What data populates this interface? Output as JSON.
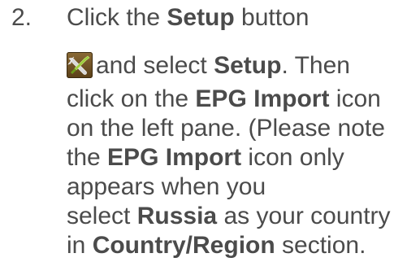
{
  "step": {
    "number": "2.",
    "line1": {
      "pre": "Click the ",
      "bold": "Setup",
      "post": " button"
    },
    "line2": {
      "pre": "and select ",
      "bold": "Setup",
      "post": ". Then"
    },
    "line3": {
      "pre": "click on the ",
      "bold": "EPG Import",
      "post": " icon"
    },
    "line4": {
      "text": "on the left pane. (Please note"
    },
    "line5": {
      "pre": "the ",
      "bold": "EPG Import",
      "post": " icon only"
    },
    "line6": {
      "text": "appears when you"
    },
    "line7": {
      "pre": "select ",
      "bold": "Russia",
      "post": " as your country"
    },
    "line8": {
      "pre": "in ",
      "bold": "Country/Region",
      "post": " section."
    }
  },
  "icons": {
    "setup": "setup-tools-icon"
  }
}
